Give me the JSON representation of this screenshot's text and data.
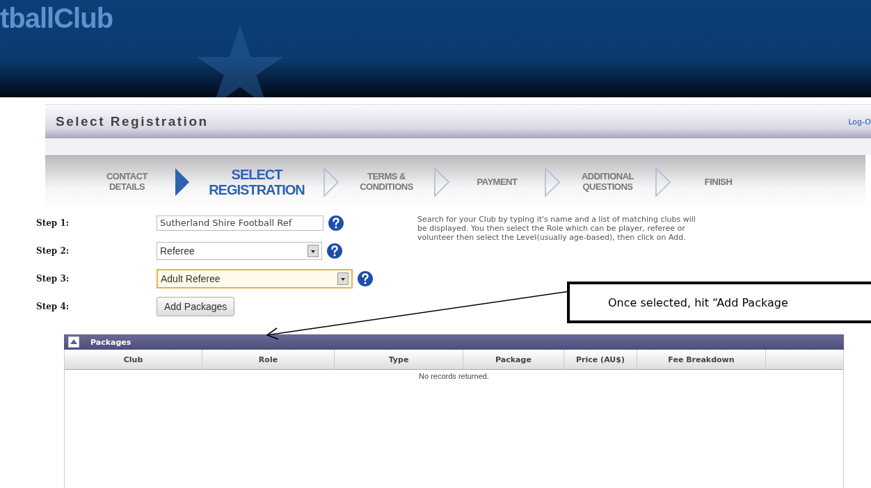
{
  "header": {
    "logo": "tballClub"
  },
  "title_bar": {
    "title": "Select Registration",
    "link": "Log-O"
  },
  "steps": [
    {
      "label": "CONTACT DETAILS",
      "selected": false
    },
    {
      "label": "SELECT REGISTRATION",
      "selected": true
    },
    {
      "label": "TERMS & CONDITIONS",
      "selected": false
    },
    {
      "label": "PAYMENT",
      "selected": false
    },
    {
      "label": "ADDITIONAL QUESTIONS",
      "selected": false
    },
    {
      "label": "FINISH",
      "selected": false
    }
  ],
  "form": [
    {
      "label": "Step 1:",
      "kind": "text",
      "value": "Sutherland Shire Football Ref",
      "focused": false,
      "help": true
    },
    {
      "label": "Step 2:",
      "kind": "select",
      "value": "Referee",
      "focused": false,
      "help": true
    },
    {
      "label": "Step 3:",
      "kind": "select",
      "value": "Adult Referee",
      "focused": true,
      "help": true
    },
    {
      "label": "Step 4:",
      "kind": "button",
      "value": "Add Packages"
    }
  ],
  "instructions": [
    "Search for your Club by typing it's name and a list of matching clubs will",
    "be displayed. You then select the Role which can be player, referee or",
    "volunteer then select the Level(usually age-based), then click on Add."
  ],
  "callout": {
    "text": "Once selected, hit “Add Package"
  },
  "packages": {
    "title": "Packages",
    "columns": [
      "Club",
      "Role",
      "Type",
      "Package",
      "Price (AU$)",
      "Fee Breakdown"
    ],
    "empty_message": "No records returned."
  }
}
